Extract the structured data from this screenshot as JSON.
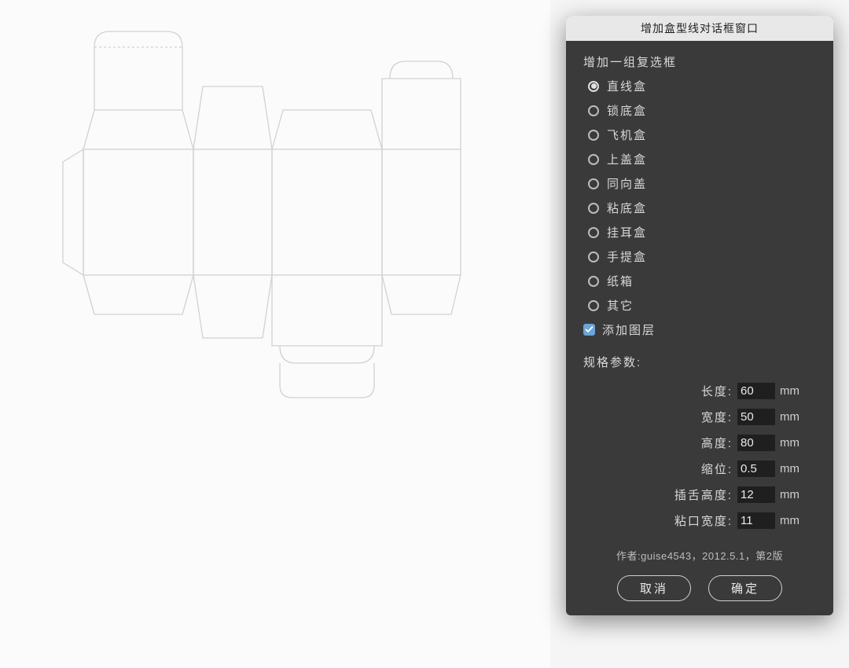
{
  "dialog": {
    "title": "增加盒型线对话框窗口",
    "group_label": "增加一组复选框",
    "box_types": [
      {
        "label": "直线盒",
        "selected": true
      },
      {
        "label": "锁底盒",
        "selected": false
      },
      {
        "label": "飞机盒",
        "selected": false
      },
      {
        "label": "上盖盒",
        "selected": false
      },
      {
        "label": "同向盖",
        "selected": false
      },
      {
        "label": "粘底盒",
        "selected": false
      },
      {
        "label": "挂耳盒",
        "selected": false
      },
      {
        "label": "手提盒",
        "selected": false
      },
      {
        "label": "纸箱",
        "selected": false
      },
      {
        "label": "其它",
        "selected": false
      }
    ],
    "add_layer": {
      "label": "添加图层",
      "checked": true
    },
    "params_label": "规格参数:",
    "params": [
      {
        "key": "length",
        "label": "长度:",
        "value": "60",
        "unit": "mm"
      },
      {
        "key": "width",
        "label": "宽度:",
        "value": "50",
        "unit": "mm"
      },
      {
        "key": "height",
        "label": "高度:",
        "value": "80",
        "unit": "mm"
      },
      {
        "key": "offset",
        "label": "缩位:",
        "value": "0.5",
        "unit": "mm"
      },
      {
        "key": "tuck_height",
        "label": "插舌高度:",
        "value": "12",
        "unit": "mm"
      },
      {
        "key": "glue_width",
        "label": "粘口宽度:",
        "value": "11",
        "unit": "mm"
      }
    ],
    "author_line": "作者:guise4543，2012.5.1，第2版",
    "buttons": {
      "cancel": "取消",
      "ok": "确定"
    }
  }
}
